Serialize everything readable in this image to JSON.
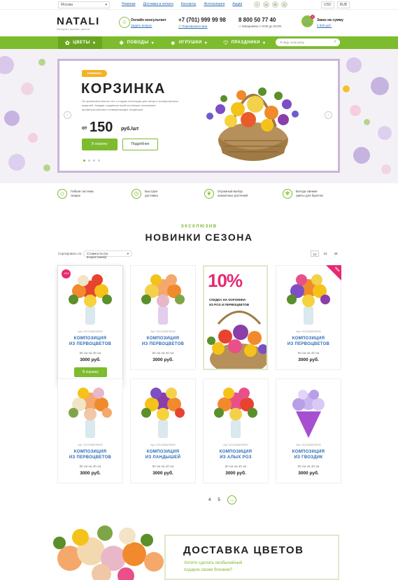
{
  "topbar": {
    "city": "Москва",
    "links": [
      "Новинки",
      "Доставка и оплата",
      "Контакты",
      "Фотогалерея",
      "Акции"
    ],
    "socials": [
      "f",
      "vk",
      "✉",
      "◎"
    ],
    "currencies": [
      "USD",
      "RUB"
    ]
  },
  "header": {
    "logo": "NATALI",
    "logo_sub": "Интернет-магазин цветов",
    "consultant_title": "Онлайн консультант",
    "consultant_link": "Задать вопрос",
    "phone1": "+7 (701) 999 99 98",
    "phone1_link": "Перезвоните мне",
    "phone2": "8 800 50 77 40",
    "phone2_sub": "Ежедневно с 8:00 до 20:00",
    "cart_title": "Заказ на сумму",
    "cart_sum": "0 000 руб.",
    "cart_count": "1"
  },
  "nav": {
    "items": [
      {
        "label": "ЦВЕТЫ",
        "icon": "flower-icon"
      },
      {
        "label": "ПОВОДЫ",
        "icon": "gift-icon"
      },
      {
        "label": "ИГРУШКИ",
        "icon": "bear-icon"
      },
      {
        "label": "ПРАЗДНИКИ",
        "icon": "heart-icon"
      }
    ],
    "search_placeholder": "Я ищу, хочу розу"
  },
  "hero": {
    "tag": "НОВИНКА",
    "title": "КОРЗИНКА",
    "description": "Не прилагаем многих лет к создаю коллекции для танца и тренировочных моделей. Каждая созданная мной коллекция показывает профессионализм и коммуникацию тенденции.",
    "price_from": "от",
    "price": "150",
    "price_unit": "руб./шт",
    "btn_cart": "В корзину",
    "btn_more": "Подробнее"
  },
  "features": [
    {
      "text1": "Гибкая система",
      "text2": "скидок",
      "icon": "tag-icon"
    },
    {
      "text1": "Быстрая",
      "text2": "доставка",
      "icon": "clock-icon"
    },
    {
      "text1": "Огромный выбор",
      "text2": "комнатных растений",
      "icon": "plant-icon"
    },
    {
      "text1": "Всегда свежие",
      "text2": "цветы для букетов",
      "icon": "flower-fresh-icon"
    }
  ],
  "section": {
    "kicker": "ЭКСКЛЮЗИВ",
    "title": "НОВИНКИ СЕЗОНА",
    "sort_label": "Сортировать по:",
    "sort_value": "Стоимости (по возрастанию)",
    "per_page": [
      "12",
      "24",
      "48"
    ]
  },
  "products": [
    {
      "art": "Арт. 0212345678900",
      "name1": "КОМПОЗИЦИЯ",
      "name2": "ИЗ ПЕРВОЦВЕТОВ",
      "size": "50 см на 40 см",
      "price": "3000 руб.",
      "badge": "-15%",
      "btn": "В корзину"
    },
    {
      "art": "Арт. 0212345678900",
      "name1": "КОМПОЗИЦИЯ",
      "name2": "ИЗ ПЕРВОЦВЕТОВ",
      "size": "50 см на 40 см",
      "price": "3000 руб."
    },
    {
      "art": "Арт. 0212345678900",
      "name1": "КОМПОЗИЦИЯ",
      "name2": "ИЗ ПЕРВОЦВЕТОВ",
      "size": "50 см на 40 см",
      "price": "3000 руб.",
      "badge": "NEW"
    },
    {
      "art": "Арт. 0212345678900",
      "name1": "КОМПОЗИЦИЯ",
      "name2": "ИЗ ПЕРВОЦВЕТОВ",
      "size": "50 см на 40 см",
      "price": "3000 руб."
    },
    {
      "art": "Арт. 0212345678900",
      "name1": "КОМПОЗИЦИЯ",
      "name2": "ИЗ ЛАНДЫШЕЙ",
      "size": "50 см на 40 см",
      "price": "3000 руб."
    },
    {
      "art": "Арт. 0212345678900",
      "name1": "КОМПОЗИЦИЯ",
      "name2": "ИЗ АЛЫХ РОЗ",
      "size": "50 см на 40 см",
      "price": "3000 руб."
    },
    {
      "art": "Арт. 0212345678900",
      "name1": "КОМПОЗИЦИЯ",
      "name2": "ИЗ ГВОЗДИК",
      "size": "50 см на 40 см",
      "price": "3000 руб."
    }
  ],
  "promo": {
    "percent": "10%",
    "line1": "СКИДКА НА КОРЗИНКИ",
    "line2": "ИЗ РОЗ И ПЕРВОЦВЕТОВ"
  },
  "pagination": {
    "pages": [
      "4",
      "5"
    ],
    "next": "→"
  },
  "delivery": {
    "title": "ДОСТАВКА ЦВЕТОВ",
    "sub1": "Хотите сделать необычайный",
    "sub2": "подарок своим близким?"
  },
  "colors": {
    "accent": "#7dbb2f",
    "pink": "#e62a72",
    "link": "#2a6bb5",
    "orange": "#f4b227"
  }
}
